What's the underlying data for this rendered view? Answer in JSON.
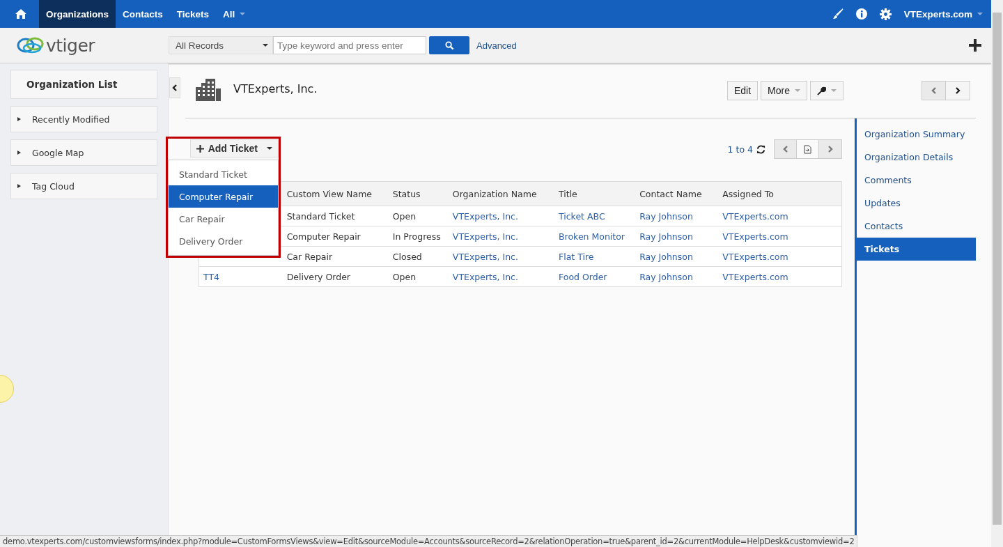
{
  "top_nav": {
    "tabs": [
      {
        "label": "Organizations",
        "selected": true
      },
      {
        "label": "Contacts",
        "selected": false
      },
      {
        "label": "Tickets",
        "selected": false
      },
      {
        "label": "All",
        "selected": false
      }
    ],
    "user": "VTExperts.com"
  },
  "header": {
    "logo": "vtiger",
    "scope": "All Records",
    "search": {
      "placeholder": "Type keyword and press enter"
    },
    "advanced": "Advanced"
  },
  "sidebar": {
    "title": "Organization List",
    "widgets": [
      {
        "label": "Recently Modified",
        "expanded": false
      },
      {
        "label": "Google Map",
        "expanded": false
      },
      {
        "label": "Tag Cloud",
        "expanded": false
      }
    ]
  },
  "record": {
    "title": "VTExperts, Inc.",
    "buttons": [
      "Edit",
      "More"
    ]
  },
  "related": {
    "add_button": "Add Ticket",
    "menu": [
      {
        "label": "Standard Ticket",
        "selected": false
      },
      {
        "label": "Computer Repair",
        "selected": true
      },
      {
        "label": "Car Repair",
        "selected": false
      },
      {
        "label": "Delivery Order",
        "selected": false
      }
    ],
    "range": "1 to 4",
    "table": {
      "columns": [
        "",
        "Custom View Name",
        "Status",
        "Organization Name",
        "Title",
        "Contact Name",
        "Assigned To"
      ],
      "rows": [
        [
          "",
          "Standard Ticket",
          "Open",
          "VTExperts, Inc.",
          "Ticket ABC",
          "Ray Johnson",
          "VTExperts.com"
        ],
        [
          "",
          "Computer Repair",
          "In Progress",
          "VTExperts, Inc.",
          "Broken Monitor",
          "Ray Johnson",
          "VTExperts.com"
        ],
        [
          "",
          "Car Repair",
          "Closed",
          "VTExperts, Inc.",
          "Flat Tire",
          "Ray Johnson",
          "VTExperts.com"
        ],
        [
          "TT4",
          "Delivery Order",
          "Open",
          "VTExperts, Inc.",
          "Food Order",
          "Ray Johnson",
          "VTExperts.com"
        ]
      ]
    }
  },
  "right_nav": [
    {
      "label": "Organization Summary",
      "selected": false
    },
    {
      "label": "Organization Details",
      "selected": false
    },
    {
      "label": "Comments",
      "selected": false
    },
    {
      "label": "Updates",
      "selected": false
    },
    {
      "label": "Contacts",
      "selected": false
    },
    {
      "label": "Tickets",
      "selected": true
    }
  ],
  "status_url": "demo.vtexperts.com/customviewsforms/index.php?module=CustomFormsViews&view=Edit&sourceModule=Accounts&sourceRecord=2&relationOperation=true&parent_id=2&currentModule=HelpDesk&customviewid=2"
}
